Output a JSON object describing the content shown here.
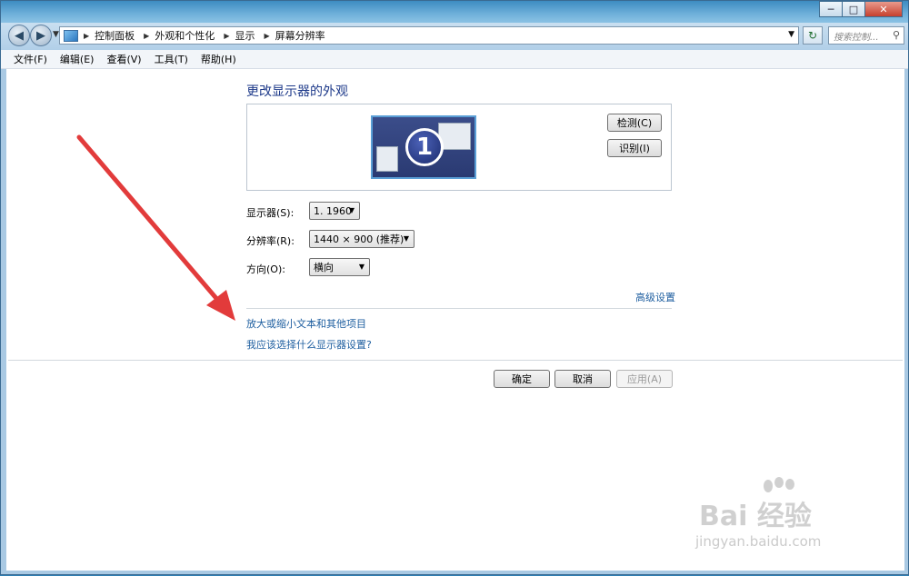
{
  "window": {
    "buttons": {
      "minimize": "─",
      "maximize": "□",
      "close": "✕"
    }
  },
  "nav": {
    "back_icon": "back-arrow-icon",
    "forward_icon": "forward-arrow-icon",
    "breadcrumbs": [
      "控制面板",
      "外观和个性化",
      "显示",
      "屏幕分辨率"
    ],
    "search_placeholder": "搜索控制..."
  },
  "menu": {
    "items": [
      "文件(F)",
      "编辑(E)",
      "查看(V)",
      "工具(T)",
      "帮助(H)"
    ]
  },
  "main": {
    "heading": "更改显示器的外观",
    "monitor_number": "1",
    "detect_label": "检测(C)",
    "identify_label": "识别(I)",
    "display_label": "显示器(S):",
    "display_value": "1. 1960",
    "resolution_label": "分辨率(R):",
    "resolution_value": "1440 × 900 (推荐)",
    "orientation_label": "方向(O):",
    "orientation_value": "横向",
    "advanced_link": "高级设置",
    "link_text_size": "放大或缩小文本和其他项目",
    "link_help": "我应该选择什么显示器设置?"
  },
  "actions": {
    "ok": "确定",
    "cancel": "取消",
    "apply": "应用(A)"
  },
  "annotation": {
    "arrow_color": "#e23b3b"
  },
  "watermark": {
    "brand": "Bai 经验",
    "url": "jingyan.baidu.com"
  }
}
